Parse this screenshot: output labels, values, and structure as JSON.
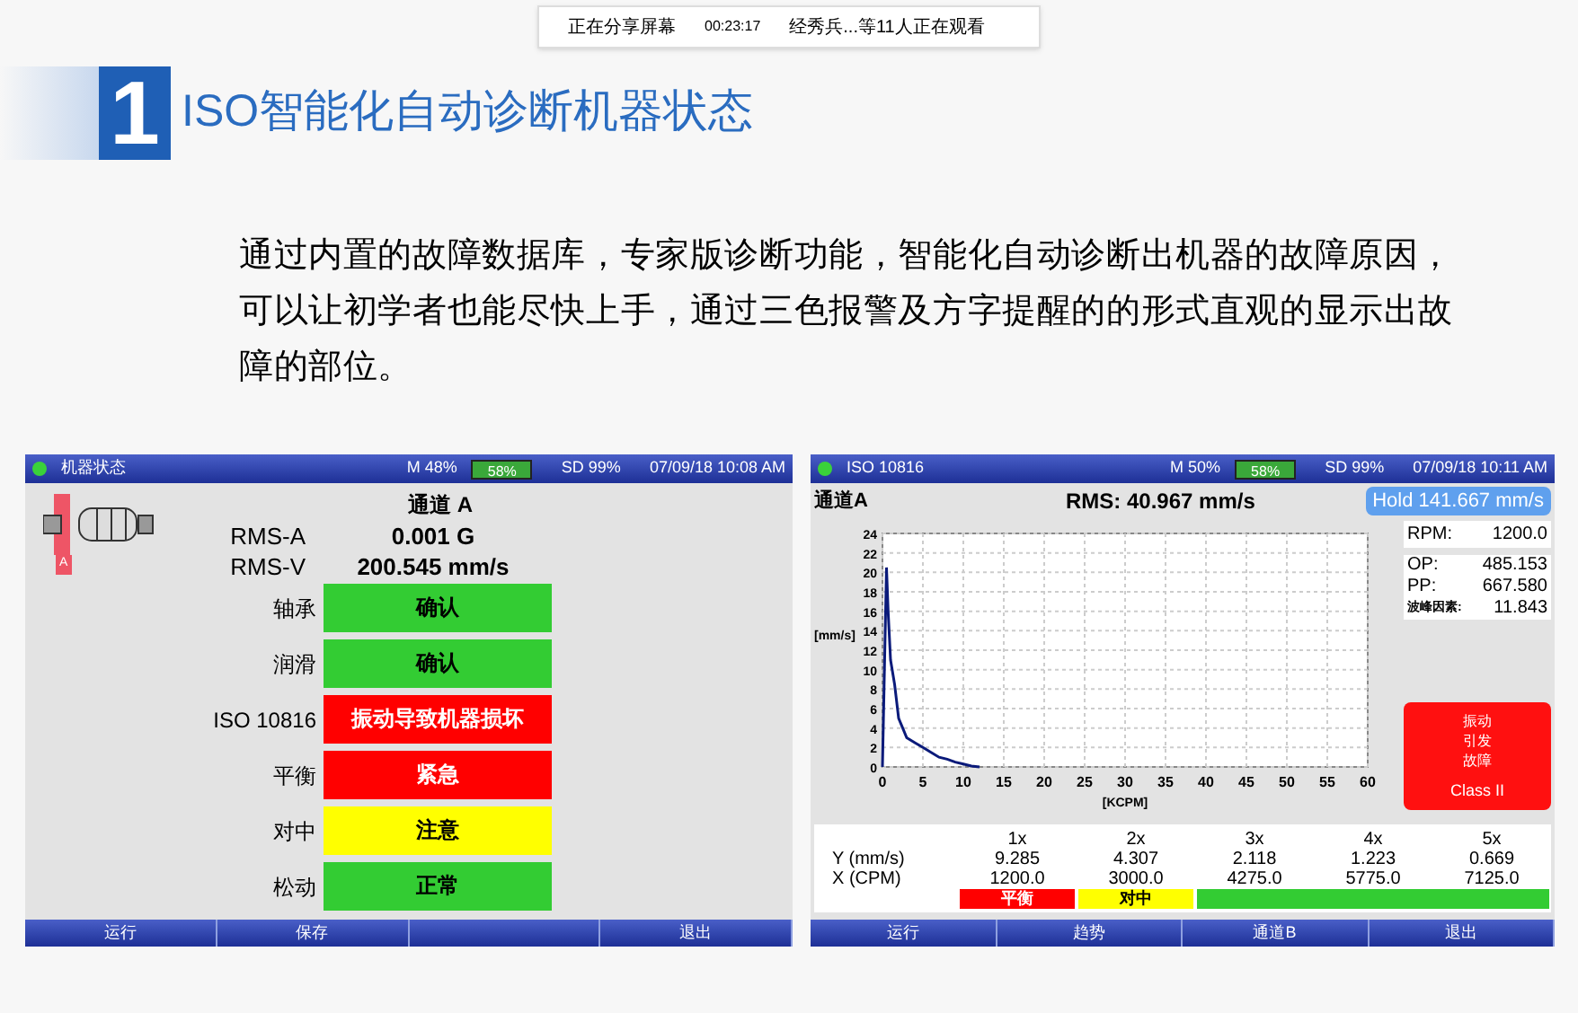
{
  "share_bar": {
    "status": "正在分享屏幕",
    "time": "00:23:17",
    "viewers": "经秀兵...等11人正在观看"
  },
  "slide": {
    "number": "1",
    "title": "ISO智能化自动诊断机器状态",
    "body": "通过内置的故障数据库，专家版诊断功能，智能化自动诊断出机器的故障原因，可以让初学者也能尽快上手，通过三色报警及方字提醒的的形式直观的显示出故障的部位。"
  },
  "left_screen": {
    "header": {
      "title": "机器状态",
      "memory": "M 48%",
      "battery": "58%",
      "storage": "SD 99%",
      "datetime": "07/09/18 10:08 AM"
    },
    "machine_label": "A",
    "channel": "通道 A",
    "readings": [
      {
        "label": "RMS-A",
        "value": "0.001 G"
      },
      {
        "label": "RMS-V",
        "value": "200.545 mm/s"
      }
    ],
    "checks": [
      {
        "label": "轴承",
        "status": "确认",
        "color": "#33cc33"
      },
      {
        "label": "润滑",
        "status": "确认",
        "color": "#33cc33"
      },
      {
        "label": "ISO 10816",
        "status": "振动导致机器损坏",
        "color": "#ff0000"
      },
      {
        "label": "平衡",
        "status": "紧急",
        "color": "#ff0000"
      },
      {
        "label": "对中",
        "status": "注意",
        "color": "#ffff00"
      },
      {
        "label": "松动",
        "status": "正常",
        "color": "#33cc33"
      }
    ],
    "footer": [
      {
        "kind": "button",
        "label": "运行"
      },
      {
        "kind": "button",
        "label": "保存"
      },
      {
        "kind": "blank"
      },
      {
        "kind": "button",
        "label": "退出"
      }
    ]
  },
  "right_screen": {
    "header": {
      "title": "ISO 10816",
      "memory": "M 50%",
      "battery": "58%",
      "storage": "SD 99%",
      "datetime": "07/09/18 10:11 AM"
    },
    "channel": "通道A",
    "rms": "RMS: 40.967 mm/s",
    "hold": "Hold 141.667 mm/s",
    "rpm": {
      "label": "RPM:",
      "value": "1200.0"
    },
    "stats": [
      {
        "label": "OP:",
        "value": "485.153"
      },
      {
        "label": "PP:",
        "value": "667.580"
      },
      {
        "label": "波峰因素:",
        "value": "11.843"
      }
    ],
    "alarm": {
      "lines": [
        "振动",
        "引发",
        "故障"
      ],
      "class": "Class II"
    },
    "chart_data": {
      "type": "line",
      "xlabel": "[KCPM]",
      "ylabel": "[mm/s]",
      "x": [
        0,
        0.5,
        0.7,
        1,
        1.5,
        2,
        2.5,
        3,
        4,
        5,
        6,
        7,
        8,
        9,
        10,
        11,
        12
      ],
      "grid": true,
      "series": [
        {
          "color": "#0a1a7a",
          "values": [
            0,
            20.5,
            16,
            11,
            8.5,
            5,
            4,
            3,
            2.5,
            2,
            1.5,
            1,
            0.8,
            0.5,
            0.3,
            0.1,
            0
          ]
        }
      ],
      "xlim": [
        0,
        60
      ],
      "ylim": [
        0,
        24
      ],
      "xticks": [
        0,
        5,
        10,
        15,
        20,
        25,
        30,
        35,
        40,
        45,
        50,
        55,
        60
      ],
      "yticks": [
        0,
        2,
        4,
        6,
        8,
        10,
        12,
        14,
        16,
        18,
        20,
        22,
        24
      ]
    },
    "harmonics": {
      "columns": [
        "1x",
        "2x",
        "3x",
        "4x",
        "5x"
      ],
      "rows": [
        {
          "label": "Y (mm/s)",
          "values": [
            "9.285",
            "4.307",
            "2.118",
            "1.223",
            "0.669"
          ]
        },
        {
          "label": "X (CPM)",
          "values": [
            "1200.0",
            "3000.0",
            "4275.0",
            "5775.0",
            "7125.0"
          ]
        }
      ],
      "tags": [
        {
          "label": "平衡",
          "color": "#ff0000"
        },
        {
          "label": "对中",
          "color": "#ffff00"
        },
        {
          "color": "#33cc33"
        }
      ]
    },
    "footer": [
      {
        "kind": "button",
        "label": "运行"
      },
      {
        "kind": "button",
        "label": "趋势"
      },
      {
        "kind": "button",
        "label": "通道B"
      },
      {
        "kind": "button",
        "label": "退出"
      }
    ]
  }
}
